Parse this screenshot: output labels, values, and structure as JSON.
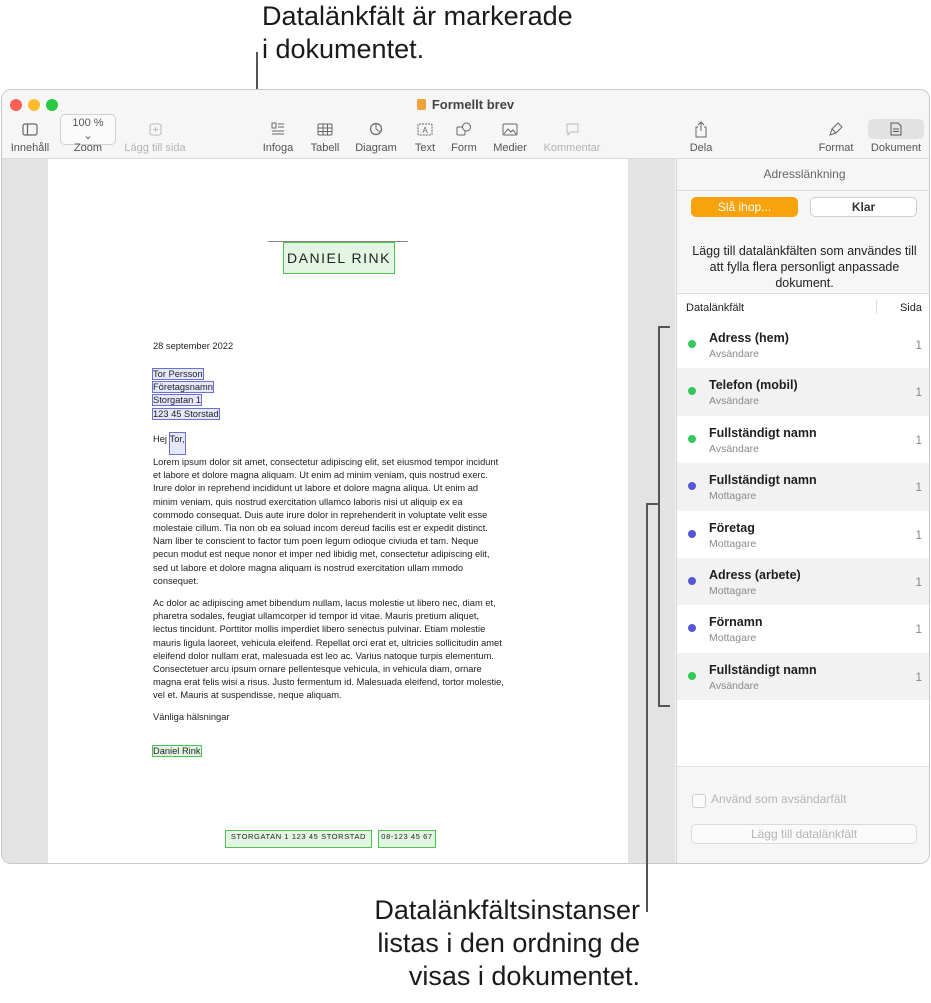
{
  "callouts": {
    "top": [
      "Datalänkfält är markerade",
      "i dokumentet."
    ],
    "bottom": [
      "Datalänkfältsinstanser",
      "listas i den ordning de",
      "visas i dokumentet."
    ]
  },
  "window": {
    "title": "Formellt brev",
    "traffic_colors": [
      "#fe5f57",
      "#febc2e",
      "#28c840"
    ]
  },
  "toolbar": {
    "innehall": "Innehåll",
    "zoom_value": "100 %",
    "zoom": "Zoom",
    "lagg_till_sida": "Lägg till sida",
    "infoga": "Infoga",
    "tabell": "Tabell",
    "diagram": "Diagram",
    "text": "Text",
    "form": "Form",
    "medier": "Medier",
    "kommentar": "Kommentar",
    "dela": "Dela",
    "format": "Format",
    "dokument": "Dokument"
  },
  "document": {
    "sender_name": "DANIEL RINK",
    "date": "28 september 2022",
    "address": [
      "Tor Persson",
      "Företagsnamn",
      "Storgatan 1",
      "123 45 Storstad"
    ],
    "greeting_prefix": "Hej",
    "greeting_name": "Tor,",
    "paragraph1": [
      "Lorem ipsum dolor sit amet, consectetur adipiscing elit, set eiusmod tempor incidunt",
      "et labore et dolore magna aliquam. Ut enim ad minim veniam, quis nostrud exerc.",
      "Irure dolor in reprehend incididunt ut labore et dolore magna aliqua. Ut enim ad",
      "minim veniam, quis nostrud exercitation ullamco laboris nisi ut aliquip ex ea",
      "commodo consequat. Duis aute irure dolor in reprehenderit in voluptate velit esse",
      "molestaie cillum. Tia non ob ea soluad incom dereud facilis est er expedit distinct.",
      "Nam liber te conscient to factor tum poen legum odioque civiuda et tam. Neque",
      "pecun modut est neque nonor et imper ned libidig met, consectetur adipiscing elit,",
      "sed ut labore et dolore magna aliquam is nostrud exercitation ullam mmodo",
      "consequet."
    ],
    "paragraph2": [
      "Ac dolor ac adipiscing amet bibendum nullam, lacus molestie ut libero nec, diam et,",
      "pharetra sodales, feugiat ullamcorper id tempor id vitae. Mauris pretium aliquet,",
      "lectus tincidunt. Porttitor mollis imperdiet libero senectus pulvinar. Etiam molestie",
      "mauris ligula laoreet, vehicula eleifend. Repellat orci erat et, ultricies sollicitudin amet",
      "eleifend dolor nullam erat, malesuada est leo ac. Varius natoque turpis elementum.",
      "Consectetuer arcu ipsum ornare pellentesque vehicula, in vehicula diam, ornare",
      "magna erat felis wisi a risus. Justo fermentum id. Malesuada eleifend, tortor molestie,",
      "vel et. Mauris at suspendisse, neque aliquam."
    ],
    "closing": "Vänliga hälsningar",
    "signature": "Daniel Rink",
    "footer_address": "STORGATAN 1   123 45 STORSTAD",
    "footer_phone": "08-123 45 67"
  },
  "sidebar": {
    "header": "Adresslänkning",
    "merge_button": "Slå ihop...",
    "done_button": "Klar",
    "description": "Lägg till datalänkfälten som användes till att fylla flera personligt anpassade dokument.",
    "col_field": "Datalänkfält",
    "col_page": "Sida",
    "fields": [
      {
        "name": "Adress (hem)",
        "role": "Avsändare",
        "page": "1",
        "color": "#34c759"
      },
      {
        "name": "Telefon (mobil)",
        "role": "Avsändare",
        "page": "1",
        "color": "#34c759"
      },
      {
        "name": "Fullständigt namn",
        "role": "Avsändare",
        "page": "1",
        "color": "#34c759"
      },
      {
        "name": "Fullständigt namn",
        "role": "Mottagare",
        "page": "1",
        "color": "#5856d6"
      },
      {
        "name": "Företag",
        "role": "Mottagare",
        "page": "1",
        "color": "#5856d6"
      },
      {
        "name": "Adress (arbete)",
        "role": "Mottagare",
        "page": "1",
        "color": "#5856d6"
      },
      {
        "name": "Förnamn",
        "role": "Mottagare",
        "page": "1",
        "color": "#5856d6"
      },
      {
        "name": "Fullständigt namn",
        "role": "Avsändare",
        "page": "1",
        "color": "#34c759"
      }
    ],
    "sender_checkbox": "Använd som avsändarfält",
    "add_field_button": "Lägg till datalänkfält"
  }
}
